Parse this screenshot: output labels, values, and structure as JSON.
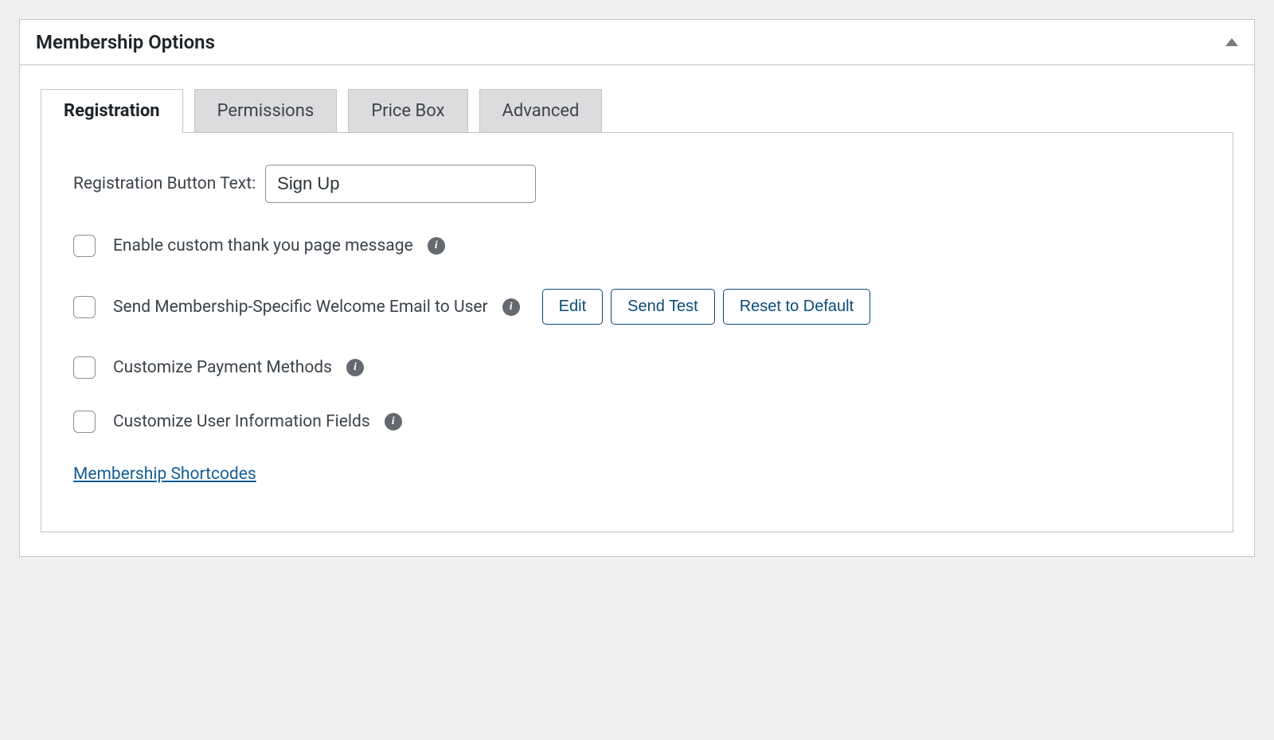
{
  "panel": {
    "title": "Membership Options"
  },
  "tabs": {
    "registration": "Registration",
    "permissions": "Permissions",
    "price_box": "Price Box",
    "advanced": "Advanced"
  },
  "registration": {
    "button_text_label": "Registration Button Text:",
    "button_text_value": "Sign Up",
    "thank_you_label": "Enable custom thank you page message",
    "welcome_email_label": "Send Membership-Specific Welcome Email to User",
    "edit_btn": "Edit",
    "send_test_btn": "Send Test",
    "reset_btn": "Reset to Default",
    "payment_methods_label": "Customize Payment Methods",
    "user_info_label": "Customize User Information Fields",
    "shortcodes_link": "Membership Shortcodes"
  }
}
